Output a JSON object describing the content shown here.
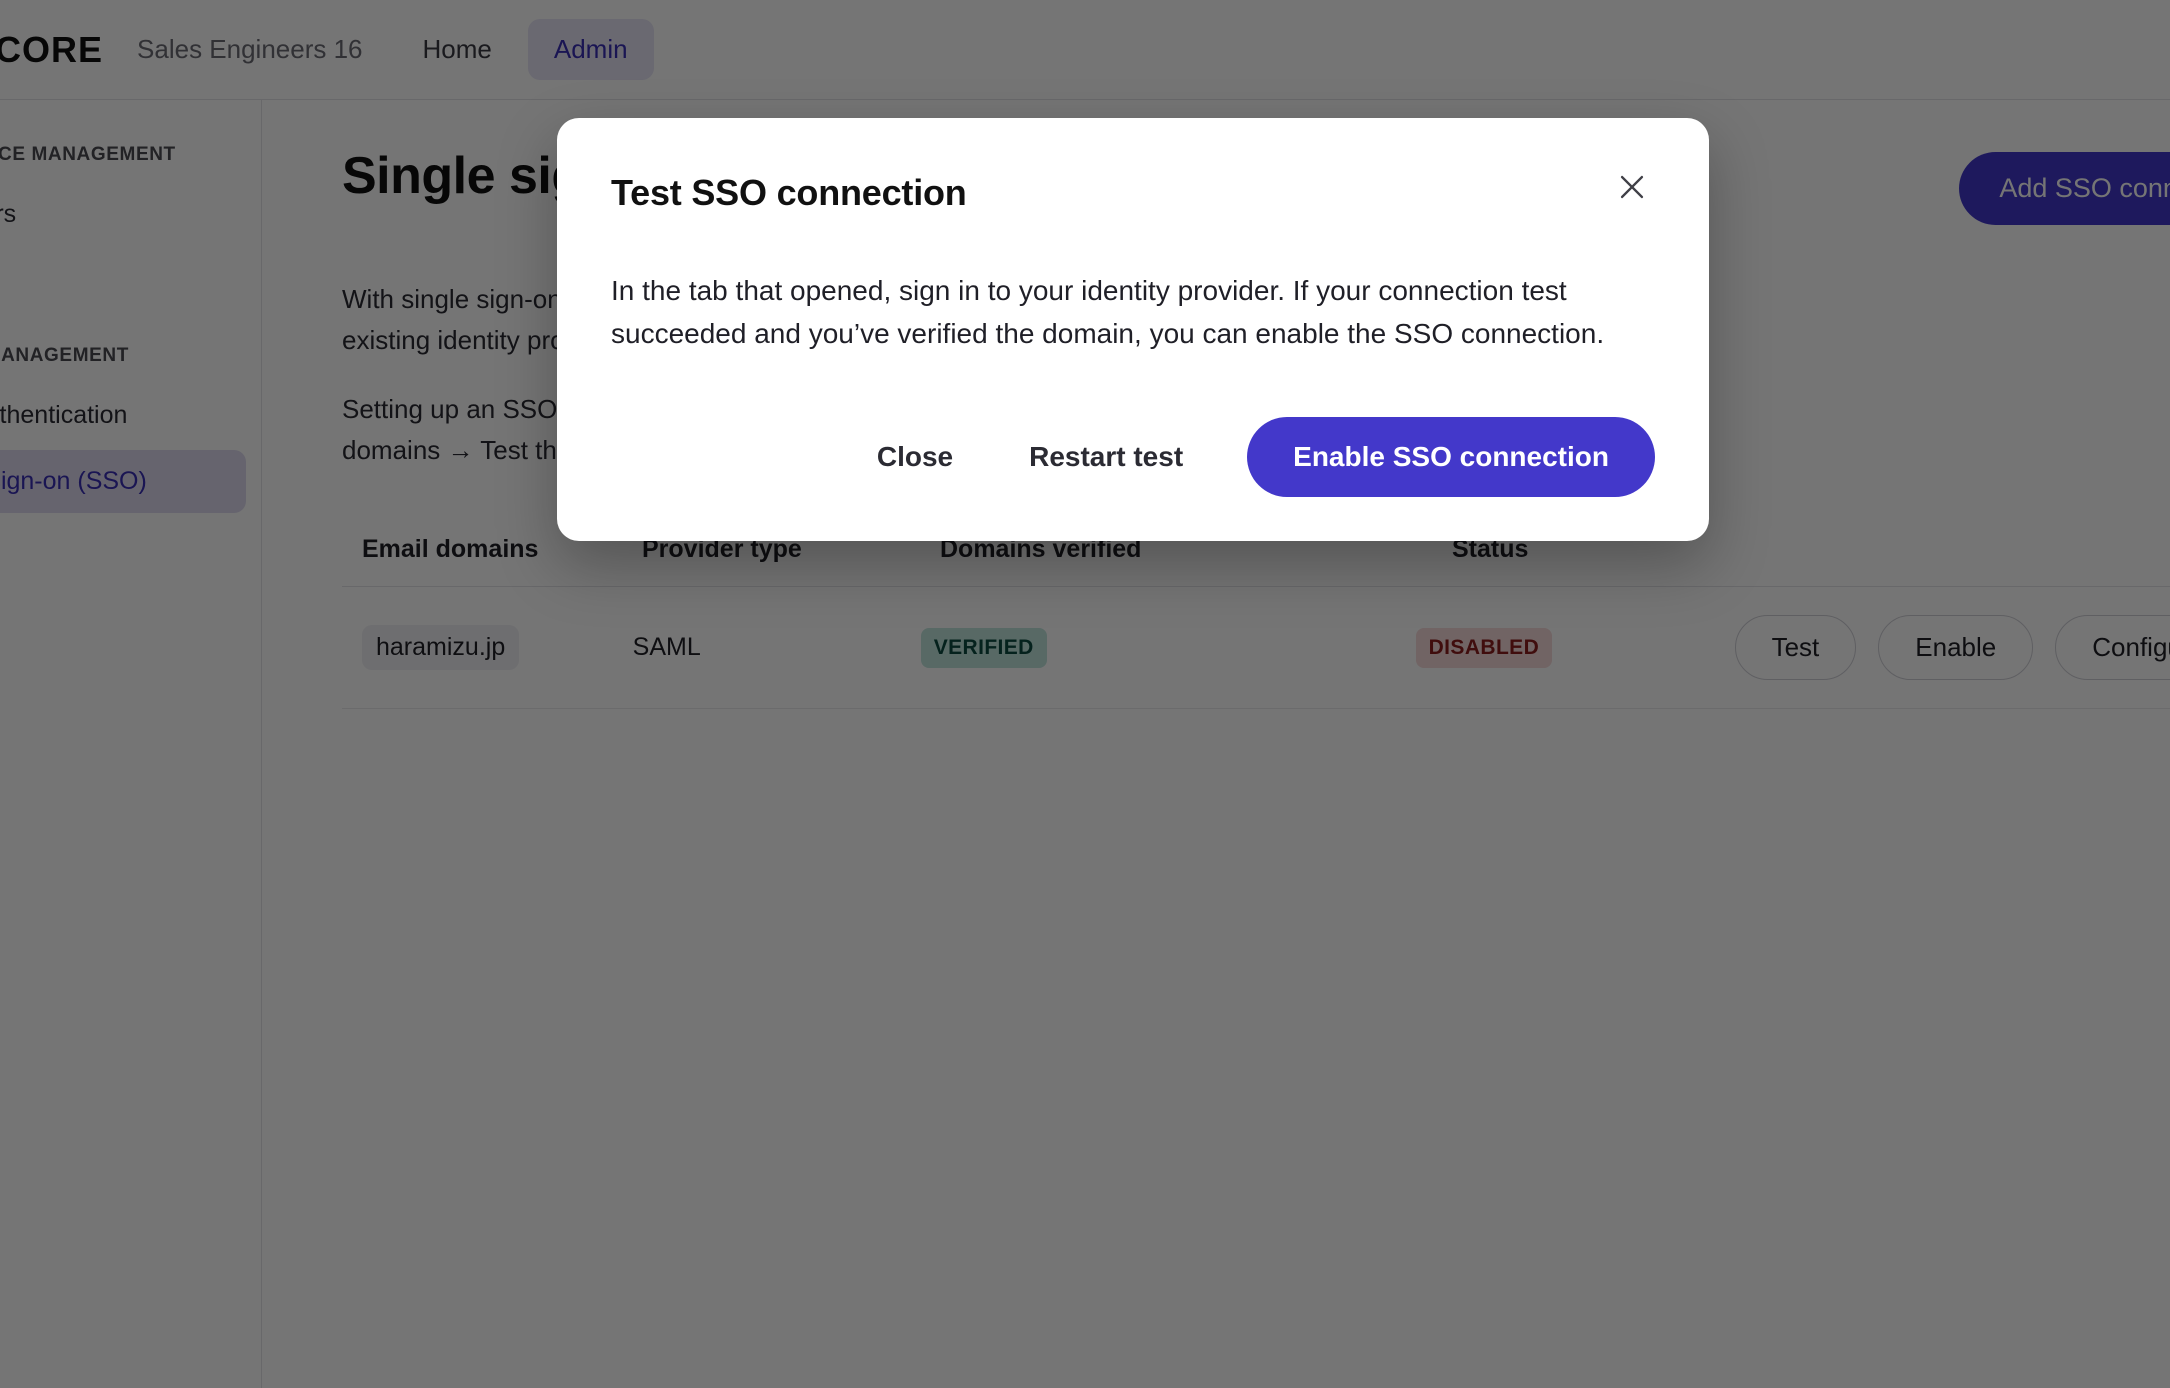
{
  "colors": {
    "accent": "#4338ca",
    "accent_soft_bg": "#e7e4f7",
    "active_nav_text": "#3a2fb5",
    "verified_bg": "#bfe4dd",
    "verified_text": "#0b4a40",
    "disabled_bg": "#f6d9d9",
    "disabled_text": "#8c1d1d",
    "scrim": "rgba(0,0,0,0.54)"
  },
  "header": {
    "brand": "ECORE",
    "workspace": "Sales Engineers 16",
    "nav": [
      {
        "label": "Home",
        "active": false
      },
      {
        "label": "Admin",
        "active": true
      }
    ]
  },
  "sidebar": {
    "sections": [
      {
        "label": "WORKSPACE MANAGEMENT",
        "items": [
          {
            "label": "Members",
            "active": false
          }
        ]
      },
      {
        "label": "ACCESS MANAGEMENT",
        "items": [
          {
            "label": "User authentication",
            "active": false
          },
          {
            "label": "Single sign-on (SSO)",
            "active": true
          }
        ]
      }
    ]
  },
  "main": {
    "title": "Single sign-on (SSO)",
    "add_button": "Add SSO connection",
    "paragraphs": [
      "With single sign-on (SSO), members can sign in using your\nexisting identity provider.",
      "Setting up an SSO connection takes three steps: add email\ndomains → Test the connection → Enable SSO."
    ],
    "table": {
      "columns": [
        "Email domains",
        "Provider type",
        "Domains verified",
        "Status"
      ],
      "rows": [
        {
          "email_domain": "haramizu.jp",
          "provider_type": "SAML",
          "domains_verified": "VERIFIED",
          "status": "DISABLED",
          "actions": [
            "Test",
            "Enable",
            "Configure"
          ]
        }
      ]
    }
  },
  "modal": {
    "title": "Test SSO connection",
    "close_icon": "close-icon",
    "body": "In the tab that opened, sign in to your identity provider. If your connection test succeeded and you’ve verified the domain, you can enable the SSO connection.",
    "buttons": {
      "close": "Close",
      "restart": "Restart test",
      "primary": "Enable SSO connection"
    }
  }
}
